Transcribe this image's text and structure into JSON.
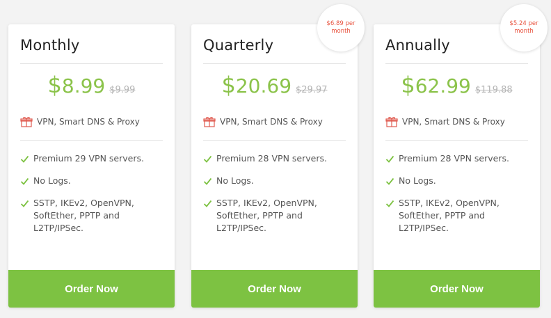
{
  "plans": [
    {
      "name": "Monthly",
      "currency": "$",
      "price": "8.99",
      "old_price": "$9.99",
      "top_feature": "VPN, Smart DNS & Proxy",
      "features": [
        "Premium 29 VPN servers.",
        "No Logs.",
        "SSTP, IKEv2, OpenVPN, SoftEther, PPTP and L2TP/IPSec."
      ],
      "button_label": "Order Now"
    },
    {
      "name": "Quarterly",
      "currency": "$",
      "price": "20.69",
      "old_price": "$29.97",
      "badge": "$6.89 per month",
      "top_feature": "VPN, Smart DNS & Proxy",
      "features": [
        "Premium 28 VPN servers.",
        "No Logs.",
        "SSTP, IKEv2, OpenVPN, SoftEther, PPTP and L2TP/IPSec."
      ],
      "button_label": "Order Now"
    },
    {
      "name": "Annually",
      "currency": "$",
      "price": "62.99",
      "old_price": "$119.88",
      "badge": "$5.24 per month",
      "top_feature": "VPN, Smart DNS & Proxy",
      "features": [
        "Premium 28 VPN servers.",
        "No Logs.",
        "SSTP, IKEv2, OpenVPN, SoftEther, PPTP and L2TP/IPSec."
      ],
      "button_label": "Order Now"
    }
  ],
  "icons": {
    "gift": "gift-icon",
    "check": "check-icon"
  },
  "colors": {
    "accent_green": "#7dc242",
    "price_green": "#8bc34a",
    "badge_red": "#e8533f",
    "gift_red": "#e05a4f"
  }
}
